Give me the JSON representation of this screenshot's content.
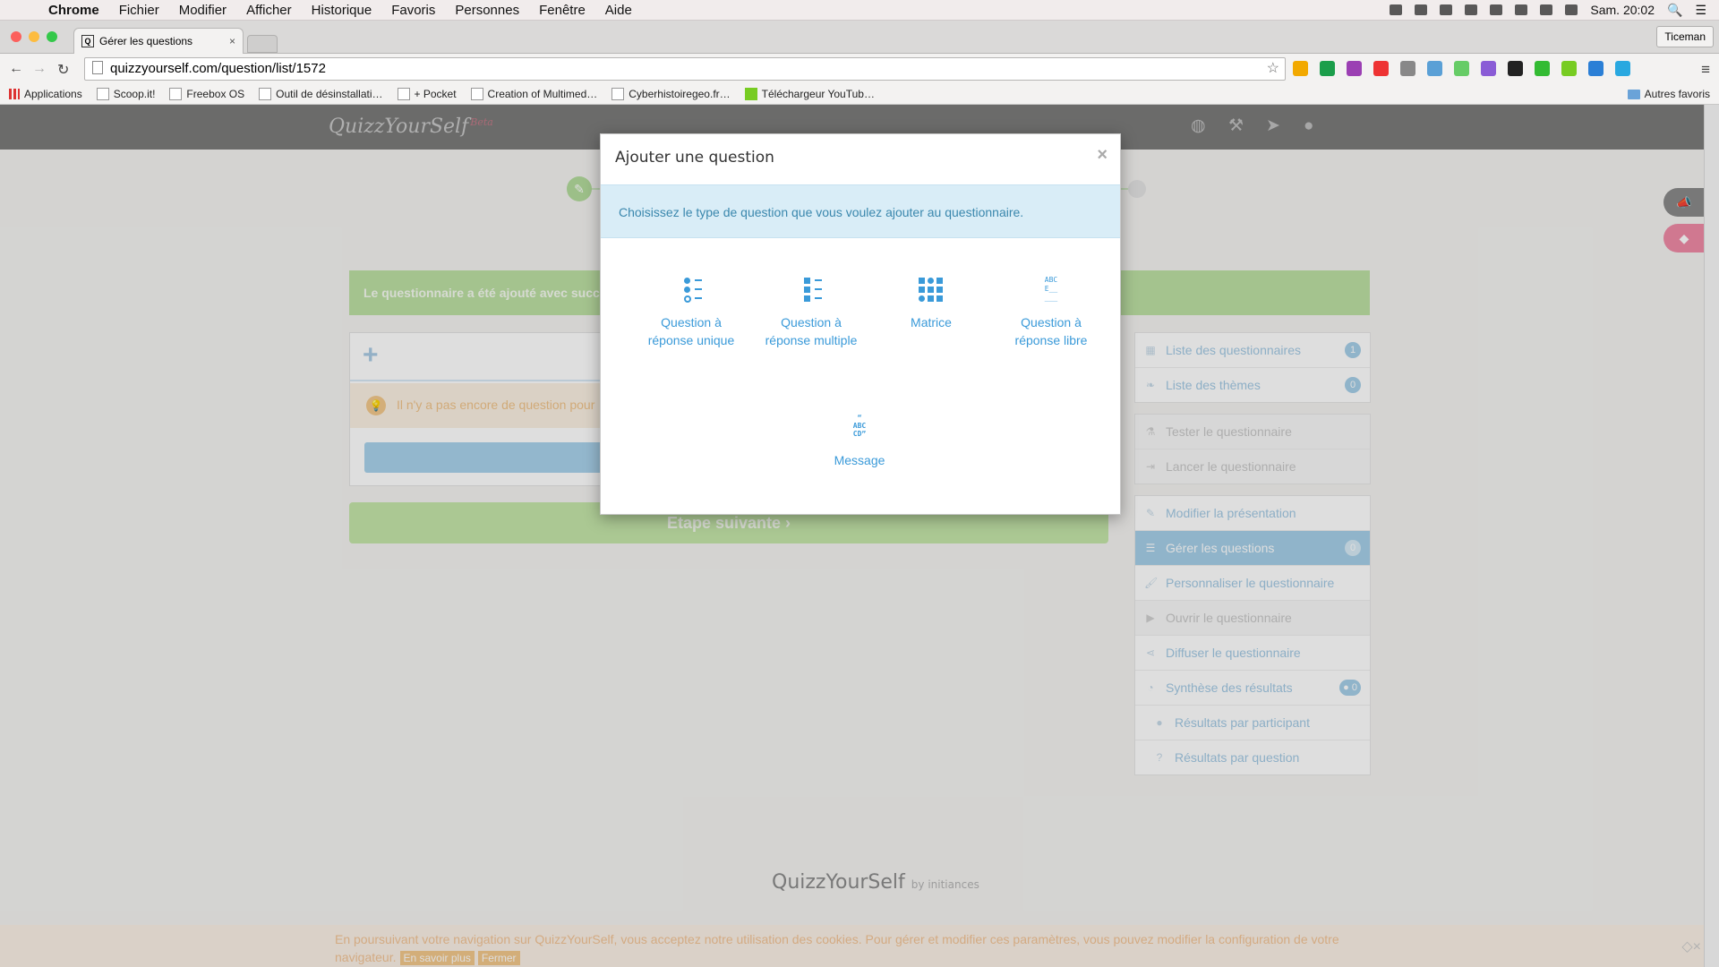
{
  "menubar": {
    "app": "Chrome",
    "items": [
      "Fichier",
      "Modifier",
      "Afficher",
      "Historique",
      "Favoris",
      "Personnes",
      "Fenêtre",
      "Aide"
    ],
    "clock": "Sam. 20:02"
  },
  "tabbar": {
    "tab_title": "Gérer les questions",
    "tab_favicon": "Q",
    "profile": "Ticeman"
  },
  "toolbar": {
    "url": "quizzyourself.com/question/list/1572"
  },
  "bookmarks": {
    "items": [
      "Applications",
      "Scoop.it!",
      "Freebox OS",
      "Outil de désinstallati…",
      "+ Pocket",
      "Creation of Multimed…",
      "Cyberhistoiregeo.fr…",
      "Téléchargeur YouTub…"
    ],
    "other": "Autres favoris"
  },
  "site": {
    "logo": "QuizzYourSelf",
    "logo_badge": "Beta"
  },
  "main": {
    "success_message": "Le questionnaire a été ajouté avec succès.",
    "no_question_message": "Il n'y a pas encore de question pour",
    "next_step": "Etape suivante",
    "next_step_icon": "chevron-right-icon"
  },
  "sidebar": {
    "group1": [
      {
        "label": "Liste des questionnaires",
        "badge": "1",
        "icon": "grid-icon"
      },
      {
        "label": "Liste des thèmes",
        "badge": "0",
        "icon": "leaf-icon"
      }
    ],
    "group2": [
      {
        "label": "Tester le questionnaire",
        "icon": "flask-icon"
      },
      {
        "label": "Lancer le questionnaire",
        "icon": "sign-in-icon"
      }
    ],
    "group3": [
      {
        "label": "Modifier la présentation",
        "icon": "pencil-icon"
      },
      {
        "label": "Gérer les questions",
        "badge": "0",
        "icon": "list-icon",
        "active": true
      },
      {
        "label": "Personnaliser le questionnaire",
        "icon": "brush-icon"
      },
      {
        "label": "Ouvrir le questionnaire",
        "icon": "play-icon"
      },
      {
        "label": "Diffuser le questionnaire",
        "icon": "share-icon"
      },
      {
        "label": "Synthèse des résultats",
        "badge": "0",
        "icon": "pie-chart-icon"
      },
      {
        "label": "Résultats par participant",
        "icon": "user-icon"
      },
      {
        "label": "Résultats par question",
        "icon": "question-icon"
      }
    ]
  },
  "footer": {
    "logo": "QuizzYourSelf",
    "by": "by initiances"
  },
  "cookie": {
    "text": "En poursuivant votre navigation sur QuizzYourSelf, vous acceptez notre utilisation des cookies. Pour gérer et modifier ces paramètres, vous pouvez modifier la configuration de votre navigateur.",
    "learn_more": "En savoir plus",
    "close": "Fermer"
  },
  "modal": {
    "title": "Ajouter une question",
    "info": "Choisissez le type de question que vous voulez ajouter au questionnaire.",
    "types": [
      {
        "label": "Question à réponse unique",
        "icon": "single-choice-icon"
      },
      {
        "label": "Question à réponse multiple",
        "icon": "multiple-choice-icon"
      },
      {
        "label": "Matrice",
        "icon": "matrix-icon"
      },
      {
        "label": "Question à réponse libre",
        "icon": "free-text-icon"
      },
      {
        "label": "Message",
        "icon": "message-quote-icon"
      }
    ]
  },
  "colors": {
    "accent": "#3a9ad9",
    "success": "#bde0a4",
    "info_bg": "#d9edf7",
    "header": "#7b7b7a"
  }
}
